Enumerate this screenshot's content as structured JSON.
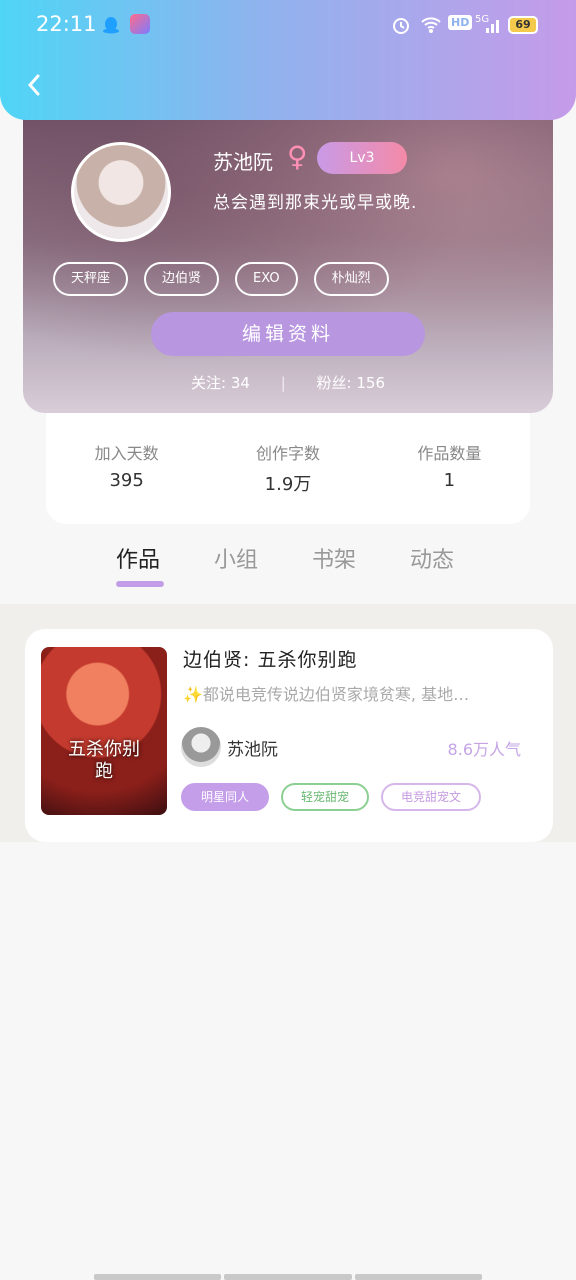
{
  "status_bar": {
    "time": "22:11",
    "battery": "69",
    "icons": [
      "qq-icon",
      "app-icon",
      "alarm-icon",
      "wifi-icon",
      "hd-icon",
      "5g-signal-icon",
      "battery-icon"
    ],
    "hd": "HD",
    "signal": "5G"
  },
  "nav": {
    "back_icon": "chevron-left-icon"
  },
  "profile": {
    "name": "苏池阮",
    "gender_symbol": "♀",
    "level": "Lv3",
    "signature": "总会遇到那束光或早或晚.",
    "tags": [
      "天秤座",
      "边伯贤",
      "EXO",
      "朴灿烈"
    ],
    "edit_label": "编辑资料",
    "following_label": "关注:",
    "following_value": "34",
    "fans_label": "粉丝:",
    "fans_value": "156"
  },
  "stats": [
    {
      "label": "加入天数",
      "value": "395"
    },
    {
      "label": "创作字数",
      "value": "1.9万"
    },
    {
      "label": "作品数量",
      "value": "1"
    }
  ],
  "tabs": [
    {
      "label": "作品",
      "active": true
    },
    {
      "label": "小组",
      "active": false
    },
    {
      "label": "书架",
      "active": false
    },
    {
      "label": "动态",
      "active": false
    }
  ],
  "work": {
    "cover_title": "五杀你别跑",
    "title": "边伯贤: 五杀你别跑",
    "description": "✨都说电竞传说边伯贤家境贫寒, 基地…",
    "author": "苏池阮",
    "popularity": "8.6万人气",
    "tags": [
      "明星同人",
      "轻宠甜宠",
      "电竞甜宠文"
    ]
  },
  "colors": {
    "header_start": "#4fd5f6",
    "header_end": "#c59be9",
    "accent": "#c49ee8"
  }
}
